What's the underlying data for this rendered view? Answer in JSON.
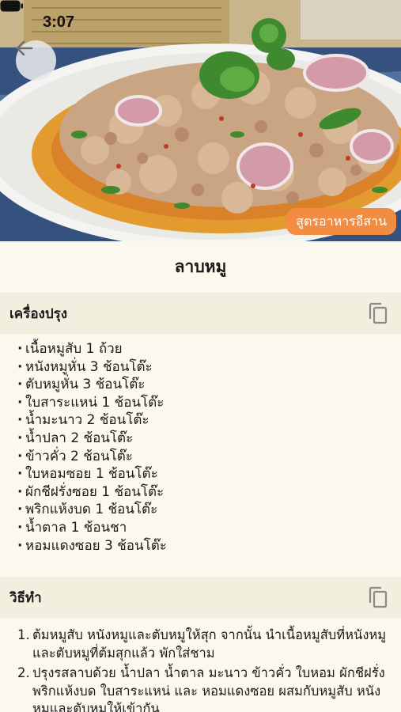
{
  "status_bar": {
    "time": "3:07"
  },
  "hero": {
    "image_description": "plate of larb moo",
    "category_badge": "สูตรอาหารอีสาน"
  },
  "recipe": {
    "title": "ลาบหมู"
  },
  "ingredients_section": {
    "heading": "เครื่องปรุง",
    "items": [
      "เนื้อหมูสับ 1 ถ้วย",
      "หนังหมูหั่น 3 ช้อนโต๊ะ",
      "ตับหมูหั่น 3 ช้อนโต๊ะ",
      "ใบสาระแหน่ 1 ช้อนโต๊ะ",
      "น้ำมะนาว 2 ช้อนโต๊ะ",
      "น้ำปลา 2 ช้อนโต๊ะ",
      "ข้าวคั่ว 2 ช้อนโต๊ะ",
      "ใบหอมซอย 1 ช้อนโต๊ะ",
      "ผักชีฝรั่งซอย 1 ช้อนโต๊ะ",
      "พริกแห้งบด 1 ช้อนโต๊ะ",
      "น้ำตาล 1 ช้อนชา",
      "หอมแดงซอย 3 ช้อนโต๊ะ"
    ]
  },
  "method_section": {
    "heading": "วิธีทำ",
    "steps": [
      {
        "num": "1.",
        "text": "ต้มหมูสับ หนังหมูและตับหมูให้สุก จากนั้น นำเนื้อหมูสับที่หนังหมูและตับหมูที่ต้มสุกแล้ว พักใส่ชาม"
      },
      {
        "num": "2.",
        "text": "ปรุงรสลาบด้วย น้ำปลา น้ำตาล มะนาว ข้าวคั่ว ใบหอม ผักชีฝรั่ง พริกแห้งบด ใบสาระแหน่ และ หอมแดงซอย ผสมกับหมูสับ หนังหมูและตับหมูให้เข้ากัน"
      }
    ]
  },
  "icons": {
    "back": "arrow-left-icon",
    "copy": "copy-icon",
    "wifi": "wifi-icon",
    "battery": "battery-icon"
  },
  "colors": {
    "badge": "#f28c41",
    "background": "#fbf8ee",
    "section_header": "#f3efde"
  }
}
